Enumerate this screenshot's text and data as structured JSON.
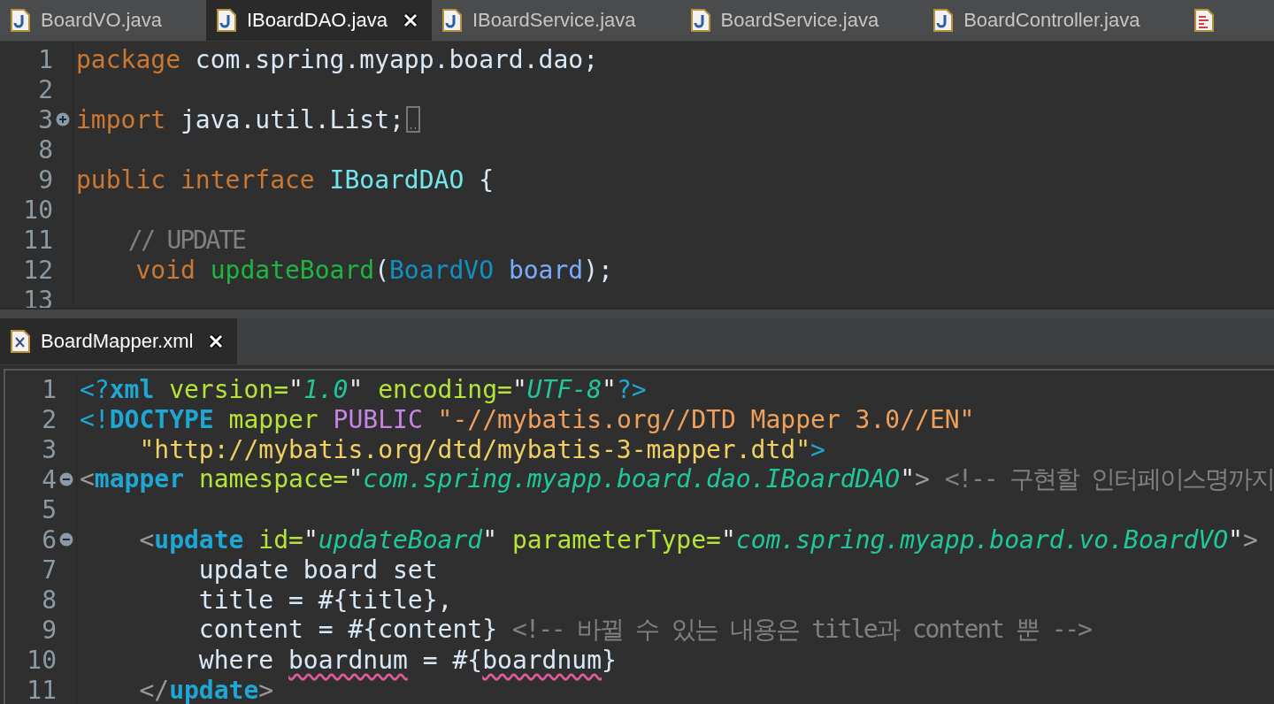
{
  "top_tabs": [
    {
      "label": "BoardVO.java",
      "kind": "java",
      "selected": false
    },
    {
      "label": "IBoardDAO.java",
      "kind": "java",
      "selected": true
    },
    {
      "label": "IBoardService.java",
      "kind": "java",
      "selected": false
    },
    {
      "label": "BoardService.java",
      "kind": "java",
      "selected": false
    },
    {
      "label": "BoardController.java",
      "kind": "java",
      "selected": false
    },
    {
      "kind": "text",
      "selected": false
    }
  ],
  "top_editor": {
    "lines": [
      {
        "number": "1",
        "tokens": [
          {
            "kind": "kw",
            "text": "package "
          },
          {
            "kind": "plain",
            "text": "com.spring.myapp.board.dao;"
          }
        ]
      },
      {
        "number": "2"
      },
      {
        "number": "3",
        "collapsed": true,
        "tokens": [
          {
            "kind": "kw",
            "text": "import "
          },
          {
            "kind": "plain",
            "text": "java.util.List;"
          }
        ]
      },
      {
        "number": "8"
      },
      {
        "number": "9",
        "tokens": [
          {
            "kind": "kw",
            "text": "public interface "
          },
          {
            "kind": "iface",
            "text": "IBoardDAO"
          },
          {
            "kind": "plain",
            "text": " {"
          }
        ]
      },
      {
        "number": "10"
      },
      {
        "number": "11",
        "tokens": [
          {
            "kind": "comment",
            "text": "    // UPDATE"
          }
        ]
      },
      {
        "number": "12",
        "tokens": [
          {
            "kind": "kw",
            "text": "    void "
          },
          {
            "kind": "method",
            "text": "updateBoard"
          },
          {
            "kind": "plain",
            "text": "("
          },
          {
            "kind": "type",
            "text": "BoardVO "
          },
          {
            "kind": "param",
            "text": "board"
          },
          {
            "kind": "plain",
            "text": ");"
          }
        ]
      },
      {
        "number": "13"
      }
    ]
  },
  "bottom_tabs": [
    {
      "label": "BoardMapper.xml",
      "kind": "xml",
      "selected": true
    }
  ],
  "bottom_editor": {
    "lines": [
      {
        "number": "1",
        "tokens": [
          {
            "kind": "decl",
            "text": "<?"
          },
          {
            "kind": "tag",
            "text": "xml "
          },
          {
            "kind": "attr",
            "text": "version="
          },
          {
            "kind": "quote",
            "text": "\""
          },
          {
            "kind": "value",
            "text": "1.0"
          },
          {
            "kind": "quote",
            "text": "\" "
          },
          {
            "kind": "attr",
            "text": "encoding="
          },
          {
            "kind": "quote",
            "text": "\""
          },
          {
            "kind": "value",
            "text": "UTF-8"
          },
          {
            "kind": "quote",
            "text": "\""
          },
          {
            "kind": "decl",
            "text": "?>"
          }
        ]
      },
      {
        "number": "2",
        "tokens": [
          {
            "kind": "decl",
            "text": "<!"
          },
          {
            "kind": "tag",
            "text": "DOCTYPE "
          },
          {
            "kind": "attr",
            "text": "mapper "
          },
          {
            "kind": "public",
            "text": "PUBLIC "
          },
          {
            "kind": "pubid",
            "text": "\"-//mybatis.org//DTD Mapper 3.0//EN\""
          }
        ]
      },
      {
        "number": "3",
        "tokens": [
          {
            "kind": "sysid",
            "text": "    \"http://mybatis.org/dtd/mybatis-3-mapper.dtd\""
          },
          {
            "kind": "decl",
            "text": ">"
          }
        ]
      },
      {
        "number": "4",
        "collapsed": false,
        "tokens": [
          {
            "kind": "punct",
            "text": "<"
          },
          {
            "kind": "tag",
            "text": "mapper "
          },
          {
            "kind": "attr",
            "text": "namespace="
          },
          {
            "kind": "quote",
            "text": "\""
          },
          {
            "kind": "value",
            "text": "com.spring.myapp.board.dao.IBoardDAO"
          },
          {
            "kind": "quote",
            "text": "\""
          },
          {
            "kind": "punct",
            "text": "> "
          },
          {
            "kind": "comment",
            "text": "<!-- 구현할 인터페이스명까지"
          }
        ]
      },
      {
        "number": "5"
      },
      {
        "number": "6",
        "collapsed": false,
        "tokens": [
          {
            "kind": "punct",
            "text": "    <"
          },
          {
            "kind": "tag",
            "text": "update "
          },
          {
            "kind": "attr",
            "text": "id="
          },
          {
            "kind": "quote",
            "text": "\""
          },
          {
            "kind": "value",
            "text": "updateBoard"
          },
          {
            "kind": "quote",
            "text": "\" "
          },
          {
            "kind": "attr",
            "text": "parameterType="
          },
          {
            "kind": "quote",
            "text": "\""
          },
          {
            "kind": "value",
            "text": "com.spring.myapp.board.vo.BoardVO"
          },
          {
            "kind": "quote",
            "text": "\""
          },
          {
            "kind": "punct",
            "text": ">"
          }
        ]
      },
      {
        "number": "7",
        "tokens": [
          {
            "kind": "plain",
            "text": "        update board set"
          }
        ]
      },
      {
        "number": "8",
        "tokens": [
          {
            "kind": "plain",
            "text": "        title = #{title},"
          }
        ]
      },
      {
        "number": "9",
        "tokens": [
          {
            "kind": "plain",
            "text": "        content = #{content} "
          },
          {
            "kind": "comment",
            "text": "<!-- 바뀔 수 있는 내용은 title과 content 뿐 -->"
          }
        ]
      },
      {
        "number": "10",
        "tokens": [
          {
            "kind": "plain",
            "text": "        where "
          },
          {
            "kind": "misspelled",
            "text": "boardnum"
          },
          {
            "kind": "plain",
            "text": " = #{"
          },
          {
            "kind": "misspelled",
            "text": "boardnum"
          },
          {
            "kind": "plain",
            "text": "}"
          }
        ]
      },
      {
        "number": "11",
        "tokens": [
          {
            "kind": "punct",
            "text": "    </"
          },
          {
            "kind": "tag",
            "text": "update"
          },
          {
            "kind": "punct",
            "text": ">"
          }
        ]
      }
    ]
  }
}
